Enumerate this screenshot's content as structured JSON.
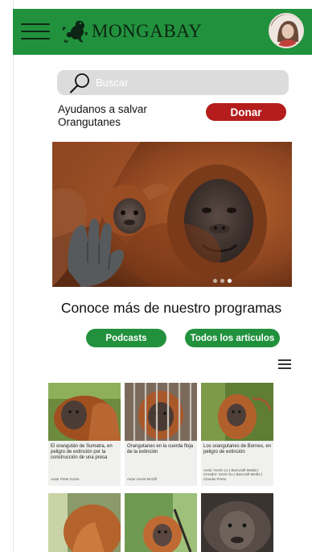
{
  "header": {
    "brand": "MONGABAY",
    "menu_icon": "hamburger-icon",
    "logo_icon": "gecko-logo-icon",
    "avatar_icon": "user-avatar",
    "bg_color": "#22913d"
  },
  "search": {
    "placeholder": "Buscar",
    "icon": "search-icon"
  },
  "donate": {
    "text": "Ayudanos a salvar Orangutanes",
    "button_label": "Donar",
    "button_color": "#b51d1d"
  },
  "hero": {
    "slide_count": 3,
    "active_slide": 3
  },
  "section_title": "Conoce más de nuestro programas",
  "buttons": {
    "podcasts": "Podcasts",
    "articles": "Todos los articulos"
  },
  "list_menu_icon": "list-menu-icon",
  "articles": [
    {
      "title": "El orangután de Sumatra, en peligro de extinción por la construcción de una presa",
      "author": "Autor Peter Kotze"
    },
    {
      "title": "Orangutanes en la cuerda floja de la extinción",
      "author": "Autor Kevin McGill"
    },
    {
      "title": "Los orangutanes de Borneo, en peligro de extinción",
      "author": "Autor: Kevin Lo | Bumcraft Media | Creador: Kevin Su | Bancraft Media | Claudio Prieto"
    },
    {
      "title": "",
      "author": ""
    },
    {
      "title": "",
      "author": ""
    },
    {
      "title": "",
      "author": ""
    }
  ]
}
